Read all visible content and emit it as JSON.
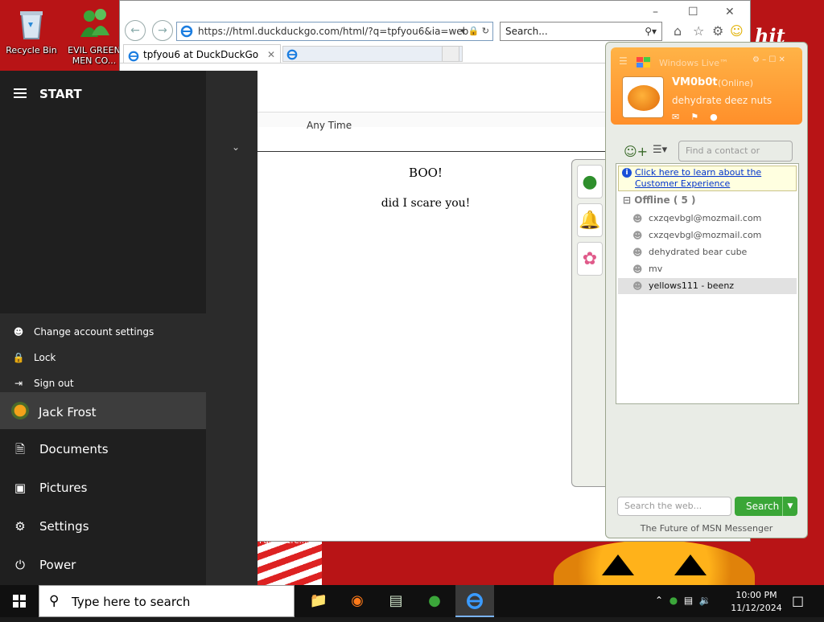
{
  "desktop": {
    "icons": [
      {
        "label": "Recycle Bin",
        "icon": "recycle-bin-icon"
      },
      {
        "label": "EVIL GREEN MEN CO...",
        "icon": "messenger-men-icon"
      }
    ],
    "background_caption": "Party scre...",
    "wallpaper_text": "hit"
  },
  "browser": {
    "url": "https://html.duckduckgo.com/html/?q=tpfyou6&ia=web",
    "search_placeholder": "Search...",
    "tab_title": "tpfyou6 at DuckDuckGo",
    "filter_label": "Any Time",
    "content_line1": "BOO!",
    "content_line2": "did I scare you!"
  },
  "start_menu": {
    "title": "START",
    "account_options": [
      {
        "label": "Change account settings",
        "icon": "person-gear-icon"
      },
      {
        "label": "Lock",
        "icon": "lock-icon"
      },
      {
        "label": "Sign out",
        "icon": "sign-out-icon"
      }
    ],
    "user_name": "Jack Frost",
    "items": [
      {
        "label": "Documents",
        "icon": "document-icon"
      },
      {
        "label": "Pictures",
        "icon": "pictures-icon"
      },
      {
        "label": "Settings",
        "icon": "gear-icon"
      },
      {
        "label": "Power",
        "icon": "power-icon"
      }
    ]
  },
  "messenger": {
    "title": "Windows Live™",
    "display_name": "VM0b0t",
    "status": "(Online)",
    "personal_message": "dehydrate deez nuts",
    "find_placeholder": "Find a contact or numbe",
    "info_banner": "Click here to learn about the Customer Experience",
    "group_label": "Offline ( 5 )",
    "contacts": [
      "cxzqevbgl@mozmail.com",
      "cxzqevbgl@mozmail.com",
      "dehydrated bear cube",
      "mv",
      "yellows111 - beenz"
    ],
    "web_placeholder": "Search the web...",
    "search_button": "Search",
    "footer": "The Future of MSN Messenger",
    "accent_color": "#ff8f2a"
  },
  "taskbar": {
    "search_placeholder": "Type here to search",
    "time": "10:00 PM",
    "date": "11/12/2024"
  }
}
